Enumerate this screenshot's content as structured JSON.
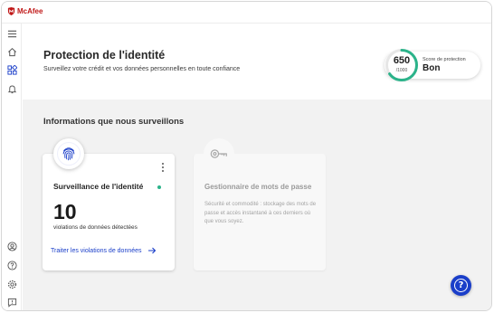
{
  "app": {
    "name": "McAfee"
  },
  "sidebar": {
    "items": [
      {
        "icon": "menu-icon"
      },
      {
        "icon": "home-icon"
      },
      {
        "icon": "apps-icon"
      },
      {
        "icon": "bell-icon"
      },
      {
        "icon": "account-icon"
      },
      {
        "icon": "help-circle-icon"
      },
      {
        "icon": "settings-icon"
      },
      {
        "icon": "feedback-icon"
      }
    ]
  },
  "header": {
    "title": "Protection de l'identité",
    "subtitle": "Surveillez votre crédit et vos données personnelles en toute confiance",
    "score": {
      "value": "650",
      "max": "/1000",
      "label": "Score de protection",
      "rating": "Bon",
      "ring_color": "#2bb38a"
    }
  },
  "main": {
    "section_title": "Informations que nous surveillons",
    "cards": [
      {
        "icon": "fingerprint-icon",
        "title": "Surveillance de l'identité",
        "count": "10",
        "count_label": "violations de données détectées",
        "link_label": "Traiter les violations de données",
        "status_color": "#2bb38a"
      },
      {
        "icon": "key-icon",
        "title": "Gestionnaire de mots de passe",
        "description": "Sécurité et commodité : stockage des mots de passe et accès instantané à ces derniers où que vous soyez."
      }
    ]
  },
  "help": {
    "icon": "question-icon",
    "label": "?"
  },
  "colors": {
    "brand": "#c01818",
    "accent": "#1a3ec9",
    "success": "#2bb38a"
  }
}
